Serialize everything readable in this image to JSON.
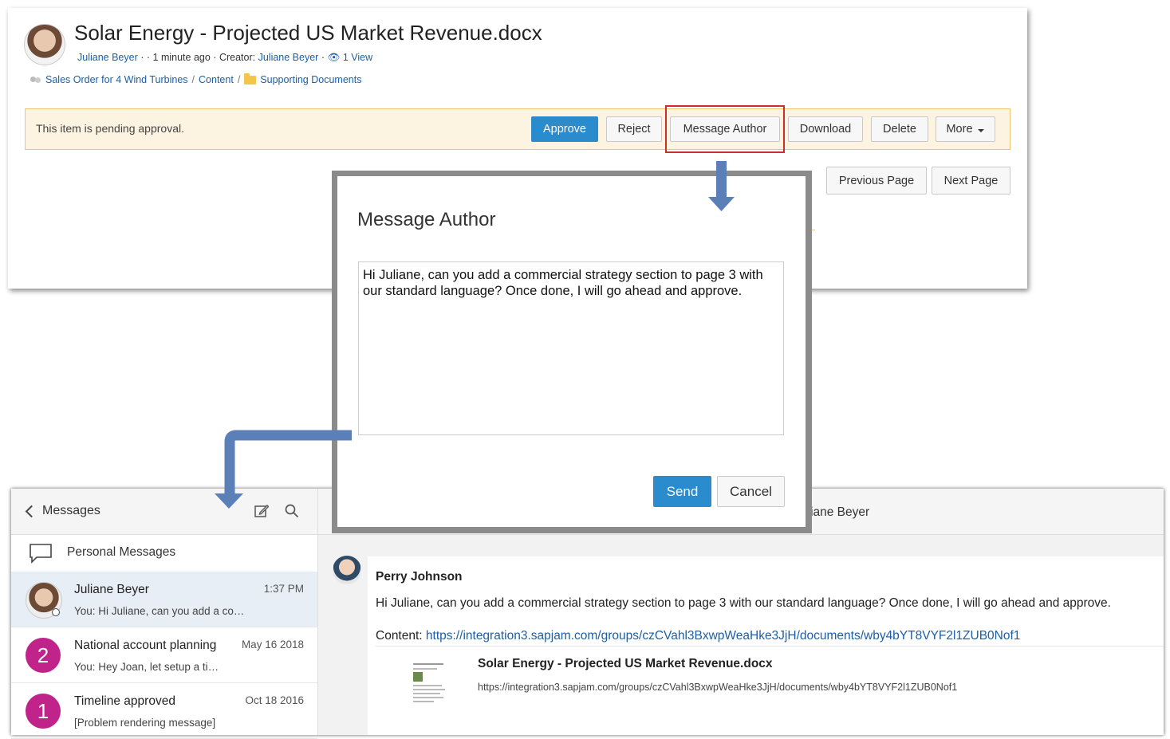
{
  "document": {
    "title": "Solar Energy - Projected US Market Revenue.docx",
    "author": "Juliane Beyer",
    "meta_sep1": "· ·",
    "time_ago": "1 minute ago",
    "meta_sep2": "·",
    "creator_label": "Creator:",
    "creator": "Juliane Beyer",
    "meta_sep3": "·",
    "views": "1 View",
    "breadcrumb": [
      "Sales Order for 4 Wind Turbines",
      "Content",
      "Supporting Documents"
    ],
    "breadcrumb_sep": "/"
  },
  "approval": {
    "pending_text": "This item is pending approval.",
    "buttons": {
      "approve": "Approve",
      "reject": "Reject",
      "message_author": "Message Author",
      "download": "Download",
      "delete": "Delete",
      "more": "More"
    }
  },
  "pagination": {
    "previous": "Previous Page",
    "next": "Next Page"
  },
  "modal": {
    "title": "Message Author",
    "message": "Hi Juliane, can you add a commercial strategy section to page 3 with our standard language? Once done, I will go ahead and approve.",
    "send": "Send",
    "cancel": "Cancel"
  },
  "messages": {
    "back_label": "Messages",
    "personal_label": "Personal Messages",
    "conversations": [
      {
        "name": "Juliane Beyer",
        "time": "1:37 PM",
        "snippet": "You: Hi Juliane, can you add a co…",
        "active": true
      },
      {
        "name": "National account planning",
        "time": "May 16 2018",
        "snippet": "You: Hey Joan, let setup a ti…",
        "badge": "2"
      },
      {
        "name": "Timeline approved",
        "time": "Oct 18 2016",
        "snippet": "[Problem rendering message]",
        "badge": "1"
      }
    ],
    "thread_name": "uliane Beyer",
    "thread": {
      "sender": "Perry Johnson",
      "text": "Hi Juliane, can you add a commercial strategy section to page 3 with our standard language? Once done, I will go ahead and approve.",
      "content_label": "Content:",
      "content_url": "https://integration3.sapjam.com/groups/czCVahl3BxwpWeaHke3JjH/documents/wby4bYT8VYF2l1ZUB0Nof1",
      "attachment_title": "Solar Energy - Projected US Market Revenue.docx",
      "attachment_url": "https://integration3.sapjam.com/groups/czCVahl3BxwpWeaHke3JjH/documents/wby4bYT8VYF2l1ZUB0Nof1"
    }
  },
  "colors": {
    "primary": "#2a8bcd",
    "link": "#1a5fa8",
    "pending_bg": "#fcf3e1",
    "pending_border": "#f0c36d",
    "highlight": "#c9302c",
    "arrow": "#5b80b8",
    "badge": "#c0248b"
  },
  "icons": [
    "people-icon",
    "folder-icon",
    "eye-icon",
    "chevron-down-icon",
    "chevron-left-icon",
    "compose-icon",
    "search-icon",
    "chat-bubble-icon"
  ]
}
